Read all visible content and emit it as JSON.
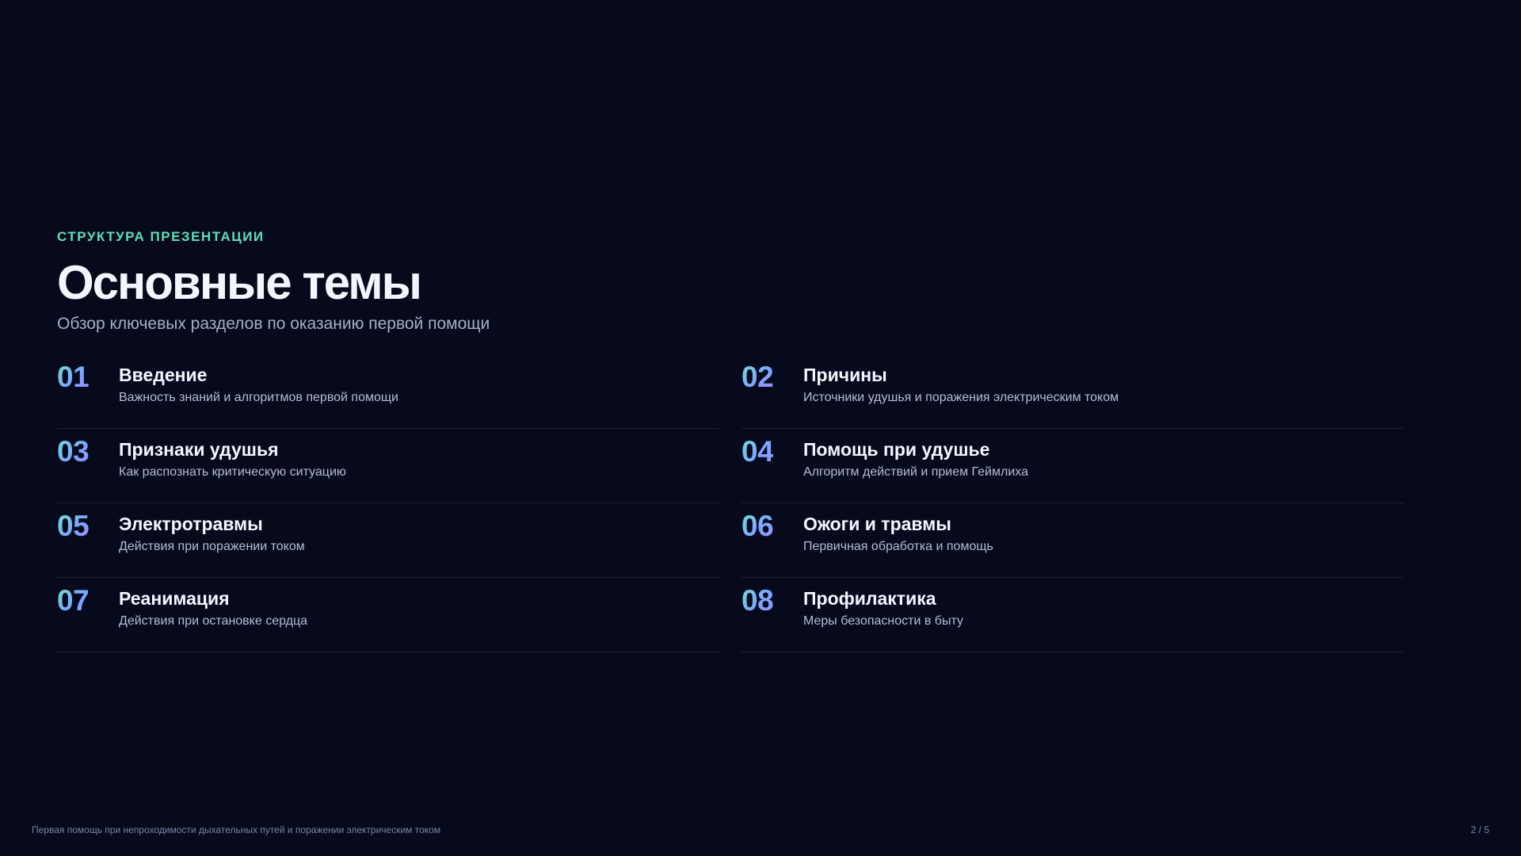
{
  "header": {
    "eyebrow": "СТРУКТУРА ПРЕЗЕНТАЦИИ",
    "title": "Основные темы",
    "subtitle": "Обзор ключевых разделов по оказанию первой помощи"
  },
  "topics": [
    {
      "num": "01",
      "title": "Введение",
      "desc": "Важность знаний и алгоритмов первой помощи"
    },
    {
      "num": "02",
      "title": "Причины",
      "desc": "Источники удушья и поражения электрическим током"
    },
    {
      "num": "03",
      "title": "Признаки удушья",
      "desc": "Как распознать критическую ситуацию"
    },
    {
      "num": "04",
      "title": "Помощь при удушье",
      "desc": "Алгоритм действий и прием Геймлиха"
    },
    {
      "num": "05",
      "title": "Электротравмы",
      "desc": "Действия при поражении током"
    },
    {
      "num": "06",
      "title": "Ожоги и травмы",
      "desc": "Первичная обработка и помощь"
    },
    {
      "num": "07",
      "title": "Реанимация",
      "desc": "Действия при остановке сердца"
    },
    {
      "num": "08",
      "title": "Профилактика",
      "desc": "Меры безопасности в быту"
    }
  ],
  "footer": {
    "caption": "Первая помощь при непроходимости дыхательных путей и поражении электрическим током",
    "page": "2 / 5"
  },
  "colors": {
    "background": "#070a1c",
    "accent": "#5ee0b8",
    "number_gradient": [
      "#6ee7d0",
      "#7aa7ff",
      "#9b8cff"
    ]
  }
}
